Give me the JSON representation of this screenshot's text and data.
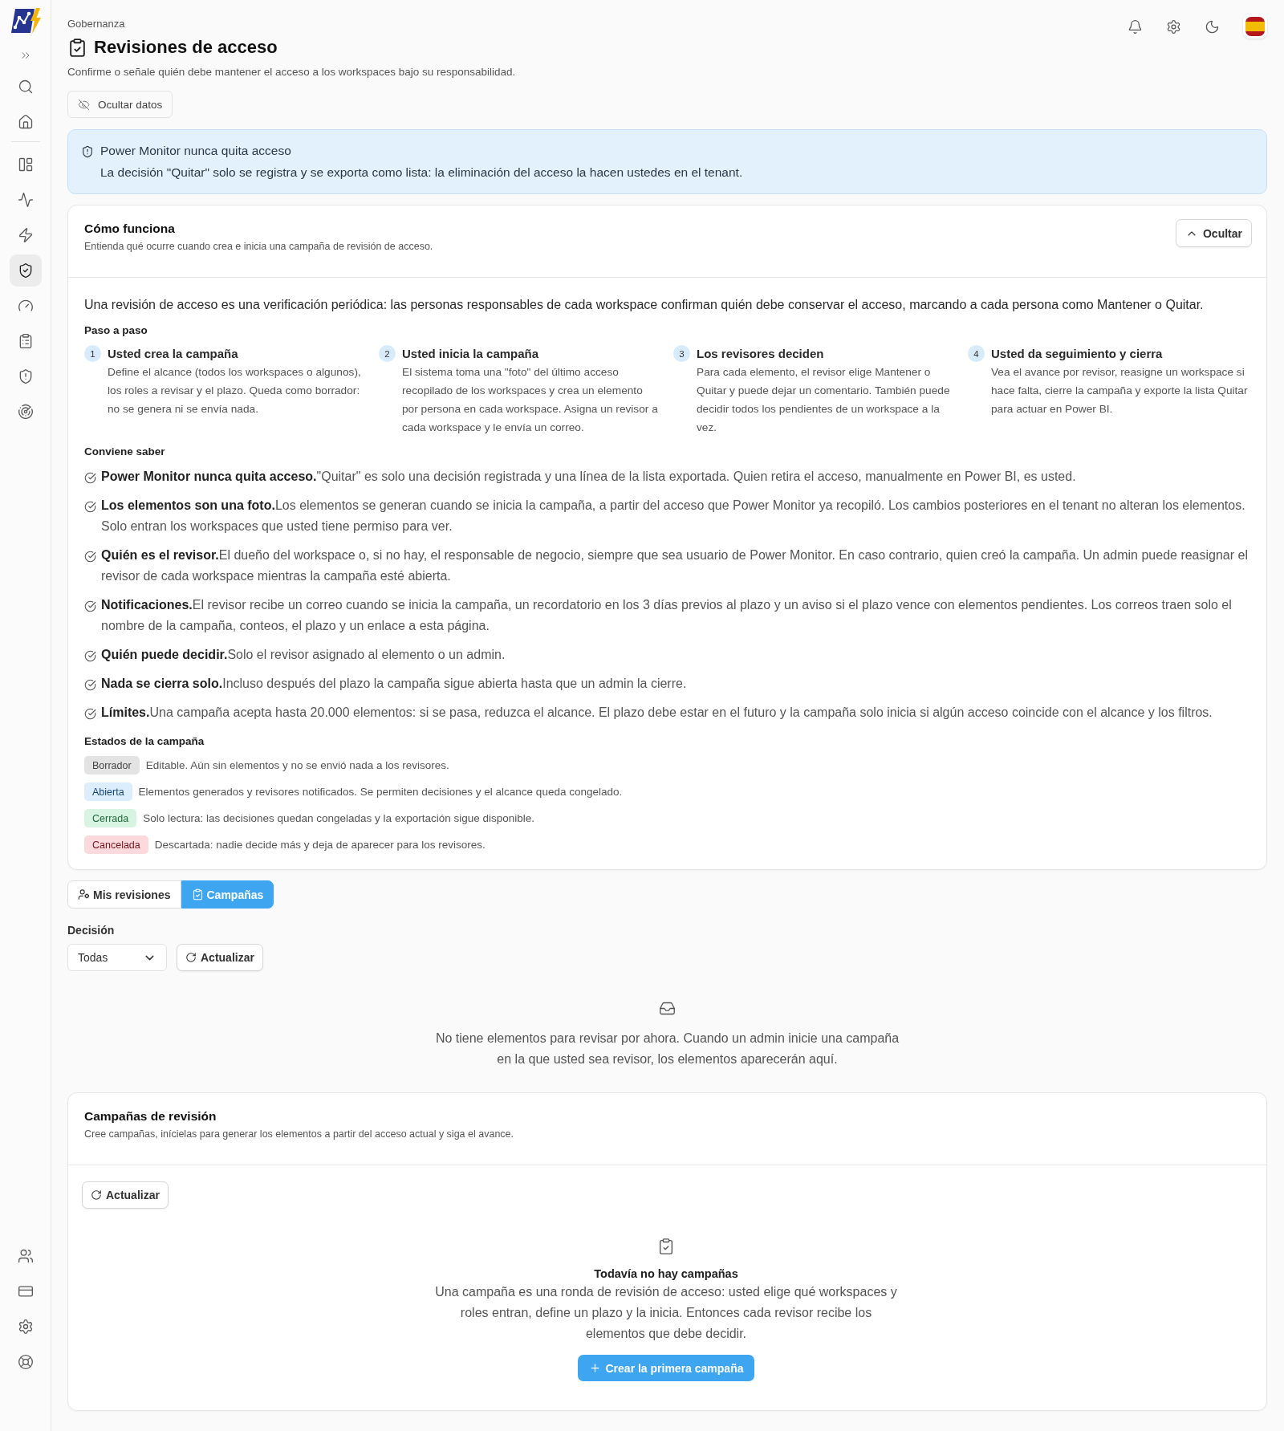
{
  "sidebar": {
    "top_items": [
      {
        "selected": false
      },
      {
        "selected": false
      }
    ],
    "nav_items": [
      {
        "selected": false
      },
      {
        "selected": false
      },
      {
        "selected": false
      },
      {
        "selected": true
      },
      {
        "selected": false
      },
      {
        "selected": false
      },
      {
        "selected": false
      },
      {
        "selected": false
      }
    ],
    "bottom_items": [
      {
        "selected": false
      },
      {
        "selected": false
      },
      {
        "selected": false
      },
      {
        "selected": false
      }
    ]
  },
  "header": {
    "breadcrumb": "Gobernanza",
    "title": "Revisiones de acceso",
    "subtitle": "Confirme o señale quién debe mantener el acceso a los workspaces bajo su responsabilidad.",
    "privacy_button": "Ocultar datos"
  },
  "banner": {
    "title": "Power Monitor nunca quita acceso",
    "text": "La decisión \"Quitar\" solo se registra y se exporta como lista: la eliminación del acceso la hacen ustedes en el tenant."
  },
  "how_it_works": {
    "title": "Cómo funciona",
    "subtitle": "Entienda qué ocurre cuando crea e inicia una campaña de revisión de acceso.",
    "collapse_button": "Ocultar",
    "expanded": true,
    "intro": "Una revisión de acceso es una verificación periódica: las personas responsables de cada workspace confirman quién debe conservar el acceso, marcando a cada persona como Mantener o Quitar.",
    "steps_heading": "Paso a paso",
    "steps": [
      {
        "number": "1",
        "title": "Usted crea la campaña",
        "description": "Define el alcance (todos los workspaces o algunos), los roles a revisar y el plazo. Queda como borrador: no se genera ni se envía nada."
      },
      {
        "number": "2",
        "title": "Usted inicia la campaña",
        "description": "El sistema toma una \"foto\" del último acceso recopilado de los workspaces y crea un elemento por persona en cada workspace. Asigna un revisor a cada workspace y le envía un correo."
      },
      {
        "number": "3",
        "title": "Los revisores deciden",
        "description": "Para cada elemento, el revisor elige Mantener o Quitar y puede dejar un comentario. También puede decidir todos los pendientes de un workspace a la vez."
      },
      {
        "number": "4",
        "title": "Usted da seguimiento y cierra",
        "description": "Vea el avance por revisor, reasigne un workspace si hace falta, cierre la campaña y exporte la lista Quitar para actuar en Power BI."
      }
    ],
    "notes_heading": "Conviene saber",
    "notes": [
      "**Power Monitor nunca quita acceso.**\"Quitar\" es solo una decisión registrada y una línea de la lista exportada. Quien retira el acceso, manualmente en Power BI, es usted.",
      "**Los elementos son una foto.**Los elementos se generan cuando se inicia la campaña, a partir del acceso que Power Monitor ya recopiló. Los cambios posteriores en el tenant no alteran los elementos. Solo entran los workspaces que usted tiene permiso para ver.",
      "**Quién es el revisor.**El dueño del workspace o, si no hay, el responsable de negocio, siempre que sea usuario de Power Monitor. En caso contrario, quien creó la campaña. Un admin puede reasignar el revisor de cada workspace mientras la campaña esté abierta.",
      "**Notificaciones.**El revisor recibe un correo cuando se inicia la campaña, un recordatorio en los 3 días previos al plazo y un aviso si el plazo vence con elementos pendientes. Los correos traen solo el nombre de la campaña, conteos, el plazo y un enlace a esta página.",
      "**Quién puede decidir.**Solo el revisor asignado al elemento o un admin.",
      "**Nada se cierra solo.**Incluso después del plazo la campaña sigue abierta hasta que un admin la cierre.",
      "**Límites.**Una campaña acepta hasta 20.000 elementos: si se pasa, reduzca el alcance. El plazo debe estar en el futuro y la campaña solo inicia si algún acceso coincide con el alcance y los filtros."
    ],
    "states_heading": "Estados de la campaña",
    "states": [
      {
        "label": "Borrador",
        "color": "#e3e3e3",
        "description": "Editable. Aún sin elementos y no se envió nada a los revisores."
      },
      {
        "label": "Abierta",
        "color": "#dcedfd",
        "description": "Elementos generados y revisores notificados. Se permiten decisiones y el alcance queda congelado."
      },
      {
        "label": "Cerrada",
        "color": "#d7f3e1",
        "description": "Solo lectura: las decisiones quedan congeladas y la exportación sigue disponible."
      },
      {
        "label": "Cancelada",
        "color": "#fbd9dc",
        "description": "Descartada: nadie decide más y deja de aparecer para los revisores."
      }
    ]
  },
  "tabs": [
    {
      "label": "Mis revisiones",
      "selected": false
    },
    {
      "label": "Campañas",
      "selected": true
    }
  ],
  "filter": {
    "label": "Decisión",
    "value": "Todas",
    "refresh_button": "Actualizar"
  },
  "my_reviews_empty": {
    "text": "No tiene elementos para revisar por ahora. Cuando un admin inicie una campaña en la que usted sea revisor, los elementos aparecerán aquí."
  },
  "campaigns": {
    "title": "Campañas de revisión",
    "subtitle": "Cree campañas, inícielas para generar los elementos a partir del acceso actual y siga el avance.",
    "refresh_button": "Actualizar",
    "empty_title": "Todavía no hay campañas",
    "empty_text": "Una campaña es una ronda de revisión de acceso: usted elige qué workspaces y roles entran, define un plazo y la inicia. Entonces cada revisor recibe los elementos que debe decidir.",
    "create_button": "Crear la primera campaña"
  }
}
